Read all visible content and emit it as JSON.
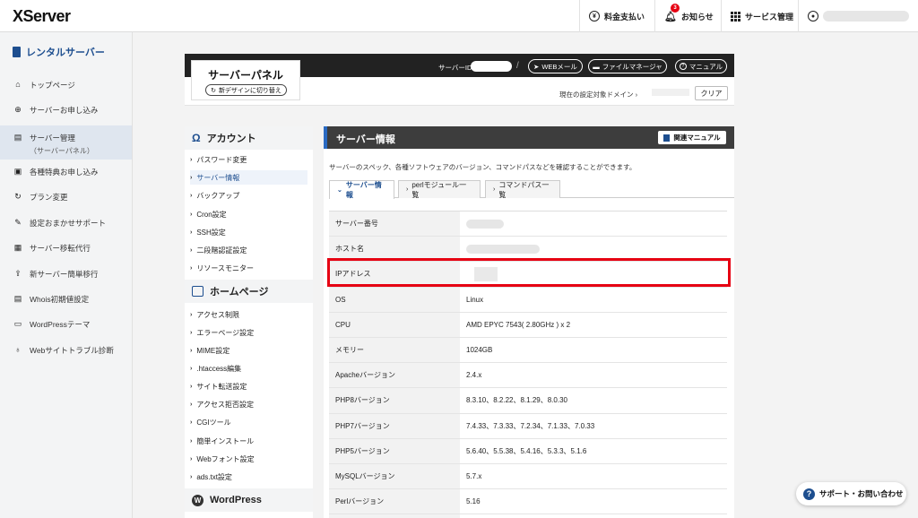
{
  "topbar": {
    "logo": "XServer",
    "payment": "料金支払い",
    "notifications": "お知らせ",
    "notification_count": "3",
    "services": "サービス管理"
  },
  "sidebar": {
    "heading": "レンタルサーバー",
    "items": [
      {
        "label": "トップページ",
        "icon": "home-icon"
      },
      {
        "label": "サーバーお申し込み",
        "icon": "plus-circle-icon"
      },
      {
        "label": "サーバー管理",
        "sub": "（サーバーパネル）",
        "icon": "server-icon"
      },
      {
        "label": "各種特典お申し込み",
        "icon": "gift-icon"
      },
      {
        "label": "プラン変更",
        "icon": "refresh-icon"
      },
      {
        "label": "設定おまかせサポート",
        "icon": "wrench-icon"
      },
      {
        "label": "サーバー移転代行",
        "icon": "truck-icon"
      },
      {
        "label": "新サーバー簡単移行",
        "icon": "upload-icon"
      },
      {
        "label": "Whois初期値設定",
        "icon": "document-icon"
      },
      {
        "label": "WordPressテーマ",
        "icon": "window-icon"
      },
      {
        "label": "Webサイトトラブル診断",
        "icon": "stethoscope-icon"
      }
    ]
  },
  "panel": {
    "title": "サーバーパネル",
    "switch_label": "新デザインに切り替え",
    "server_id_label": "サーバーID",
    "webmail": "WEBメール",
    "file_manager": "ファイルマネージャ",
    "manual": "マニュアル",
    "domain_label": "現在の設定対象ドメイン",
    "clear": "クリア"
  },
  "menu": {
    "account_heading": "アカウント",
    "account_items": [
      "パスワード変更",
      "サーバー情報",
      "バックアップ",
      "Cron設定",
      "SSH設定",
      "二段階認証設定",
      "リソースモニター"
    ],
    "homepage_heading": "ホームページ",
    "homepage_items": [
      "アクセス制限",
      "エラーページ設定",
      "MIME設定",
      ".htaccess編集",
      "サイト転送設定",
      "アクセス拒否設定",
      "CGIツール",
      "簡単インストール",
      "Webフォント設定",
      "ads.txt設定"
    ],
    "wordpress_heading": "WordPress"
  },
  "content": {
    "title": "サーバー情報",
    "manual_button": "関連マニュアル",
    "description": "サーバーのスペック、各種ソフトウェアのバージョン、コマンドパスなどを確認することができます。",
    "tabs": [
      "サーバー情報",
      "perlモジュール一覧",
      "コマンドパス一覧"
    ],
    "rows": [
      {
        "key": "サーバー番号",
        "value": ""
      },
      {
        "key": "ホスト名",
        "value": ""
      },
      {
        "key": "IPアドレス",
        "value": ""
      },
      {
        "key": "OS",
        "value": "Linux"
      },
      {
        "key": "CPU",
        "value": "AMD EPYC 7543( 2.80GHz ) x 2"
      },
      {
        "key": "メモリー",
        "value": "1024GB"
      },
      {
        "key": "Apacheバージョン",
        "value": "2.4.x"
      },
      {
        "key": "PHP8バージョン",
        "value": "8.3.10、8.2.22、8.1.29、8.0.30"
      },
      {
        "key": "PHP7バージョン",
        "value": "7.4.33、7.3.33、7.2.34、7.1.33、7.0.33"
      },
      {
        "key": "PHP5バージョン",
        "value": "5.6.40、5.5.38、5.4.16、5.3.3、5.1.6"
      },
      {
        "key": "MySQLバージョン",
        "value": "5.7.x"
      },
      {
        "key": "Perlバージョン",
        "value": "5.16"
      },
      {
        "key": "",
        "value": ""
      }
    ]
  },
  "support": {
    "label": "サポート・お問い合わせ"
  },
  "colors": {
    "accent": "#1d4e8f",
    "highlight": "#e60012",
    "header_dark": "#222222"
  }
}
